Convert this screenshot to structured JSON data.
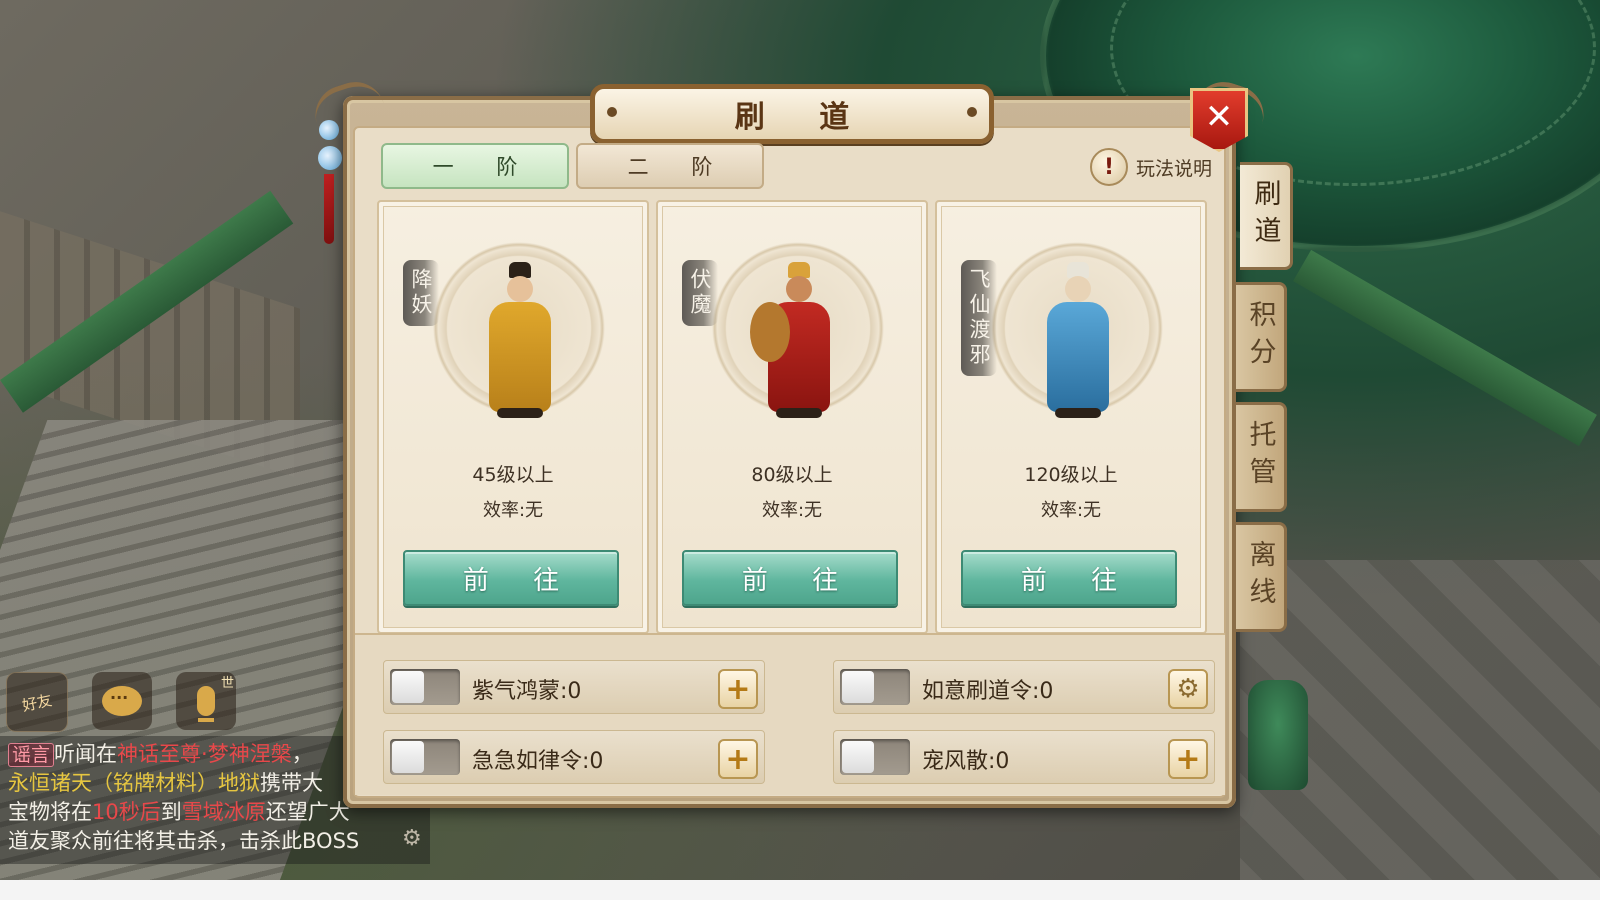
{
  "dialog": {
    "title": "刷 道",
    "tabs": [
      {
        "label": "一 阶",
        "active": true
      },
      {
        "label": "二 阶",
        "active": false
      }
    ],
    "help_label": "玩法说明",
    "close_glyph": "✕"
  },
  "side_tabs": [
    {
      "label": "刷道",
      "active": true
    },
    {
      "label": "积分",
      "active": false
    },
    {
      "label": "托管",
      "active": false
    },
    {
      "label": "离线",
      "active": false
    }
  ],
  "cards": [
    {
      "name": "降妖",
      "level": "45级以上",
      "efficiency": "效率:无",
      "button": "前 往"
    },
    {
      "name": "伏魔",
      "level": "80级以上",
      "efficiency": "效率:无",
      "button": "前 往"
    },
    {
      "name": "飞仙渡邪",
      "level": "120级以上",
      "efficiency": "效率:无",
      "button": "前 往"
    }
  ],
  "items": [
    {
      "label": "紫气鸿蒙:0",
      "action": "plus",
      "enabled": false
    },
    {
      "label": "如意刷道令:0",
      "action": "gear",
      "enabled": false
    },
    {
      "label": "急急如律令:0",
      "action": "plus",
      "enabled": false
    },
    {
      "label": "宠风散:0",
      "action": "plus",
      "enabled": false
    }
  ],
  "chat": {
    "friend_icon_label": "好友",
    "mic_badge": "世",
    "tag": "谣言",
    "line1_a": "听闻在",
    "line1_b": "神话至尊·梦神涅槃",
    "line1_c": "，",
    "line2_a": "永恒诸天（铭牌材料）地狱",
    "line2_b": "携带大",
    "line3_a": "宝物将在",
    "line3_b": "10秒后",
    "line3_c": "到",
    "line3_d": "雪域冰原",
    "line3_e": "还望广大",
    "line4": "道友聚众前往将其击杀，击杀此BOSS"
  },
  "colors": {
    "accent_green": "#5fb69e",
    "close_red": "#c8281c",
    "chat_red": "#e8484a",
    "chat_yellow": "#e6c640"
  },
  "icons": [
    "close-icon",
    "help-icon",
    "plus-icon",
    "gear-icon",
    "chat-bubble-icon",
    "microphone-icon",
    "friends-icon"
  ]
}
